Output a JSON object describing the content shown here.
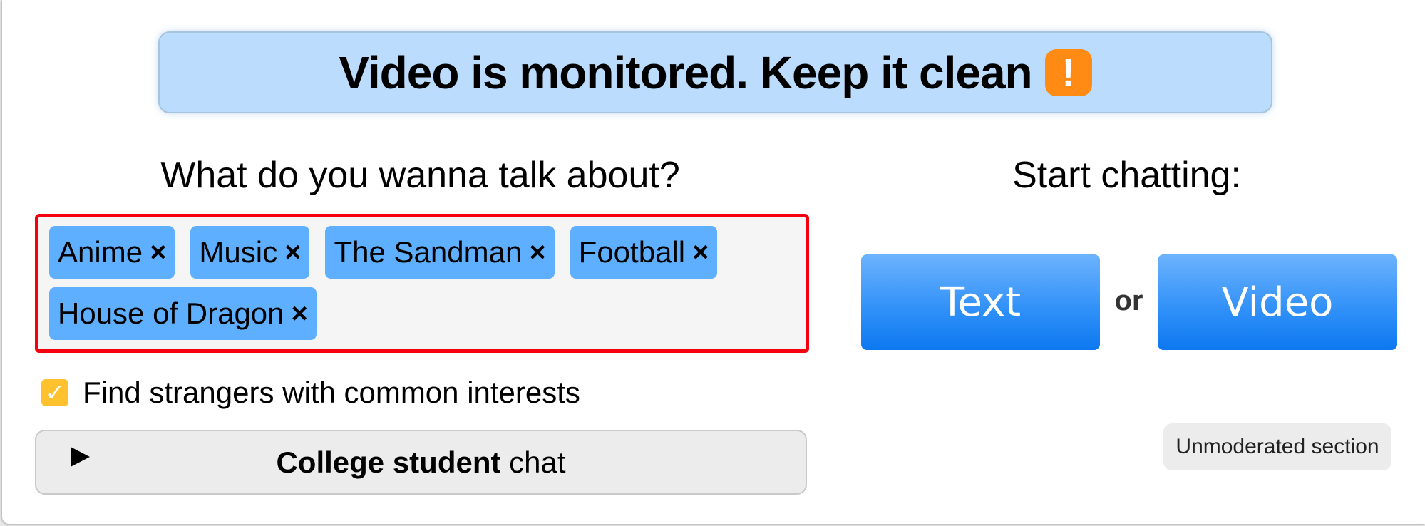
{
  "banner": {
    "text": "Video is monitored. Keep it clean",
    "icon": "exclamation-icon",
    "icon_glyph": "!",
    "icon_color": "#ff8a14",
    "background": "#bbdcfc"
  },
  "interests": {
    "heading": "What do you wanna talk about?",
    "remove_glyph": "×",
    "tags": [
      {
        "label": "Anime"
      },
      {
        "label": "Music"
      },
      {
        "label": "The Sandman"
      },
      {
        "label": "Football"
      },
      {
        "label": "House of Dragon"
      }
    ],
    "highlight_border_color": "#f5000e",
    "tag_color": "#5eafff"
  },
  "common_interests": {
    "label": "Find strangers with common interests",
    "checked": true,
    "check_glyph": "✓",
    "checkbox_color": "#ffc22e"
  },
  "college": {
    "bold_label": "College student",
    "rest_label": " chat",
    "icon": "play-icon"
  },
  "start": {
    "heading": "Start chatting:",
    "text_button": "Text",
    "or_label": "or",
    "video_button": "Video",
    "button_color": "#2e8ff8"
  },
  "unmoderated": {
    "label": "Unmoderated section"
  }
}
